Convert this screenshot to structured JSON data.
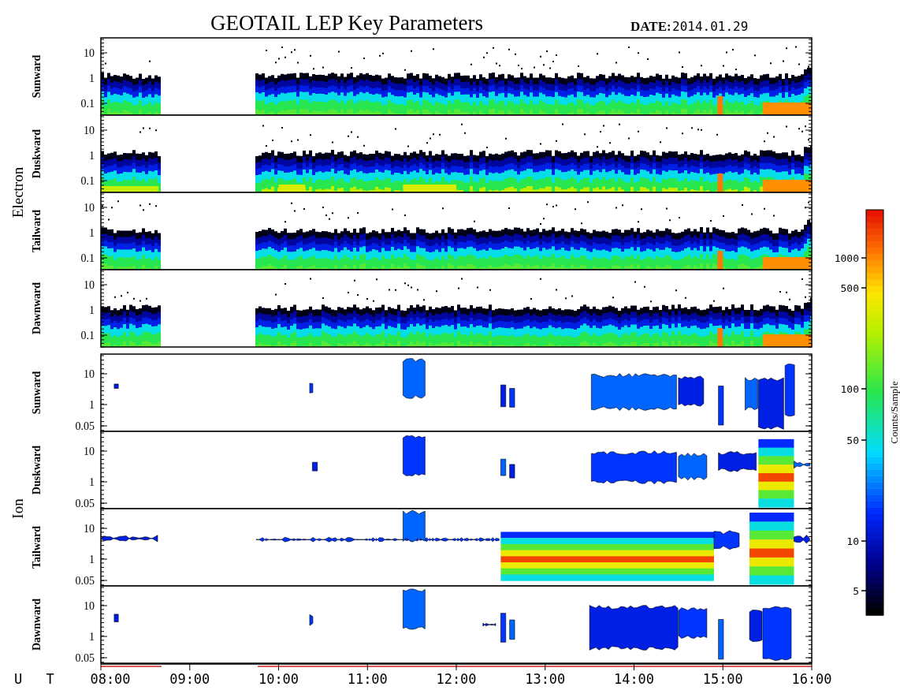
{
  "title": "GEOTAIL LEP Key Parameters",
  "date_label": "DATE:",
  "date": "2014.01.29",
  "groups": [
    {
      "species": "Electron",
      "kind": "electron",
      "panels": [
        {
          "direction": "Sunward",
          "yticks": [
            "10",
            "1",
            "0.1"
          ]
        },
        {
          "direction": "Duskward",
          "yticks": [
            "10",
            "1",
            "0.1"
          ]
        },
        {
          "direction": "Tailward",
          "yticks": [
            "10",
            "1",
            "0.1"
          ]
        },
        {
          "direction": "Dawnward",
          "yticks": [
            "10",
            "1",
            "0.1"
          ]
        }
      ]
    },
    {
      "species": "Ion",
      "kind": "ion",
      "panels": [
        {
          "direction": "Sunward",
          "yticks": [
            "10",
            "1",
            "0.05"
          ]
        },
        {
          "direction": "Duskward",
          "yticks": [
            "10",
            "1",
            "0.05"
          ]
        },
        {
          "direction": "Tailward",
          "yticks": [
            "10",
            "1",
            "0.05"
          ]
        },
        {
          "direction": "Dawnward",
          "yticks": [
            "10",
            "1",
            "0.05"
          ]
        }
      ]
    }
  ],
  "time_axis": {
    "label": "U T",
    "ticks": [
      "08:00",
      "09:00",
      "10:00",
      "11:00",
      "12:00",
      "13:00",
      "14:00",
      "15:00",
      "16:00"
    ]
  },
  "colorbar": {
    "label": "Counts/Sample",
    "ticks": [
      "1000",
      "500",
      "100",
      "50",
      "10",
      "5"
    ]
  }
}
